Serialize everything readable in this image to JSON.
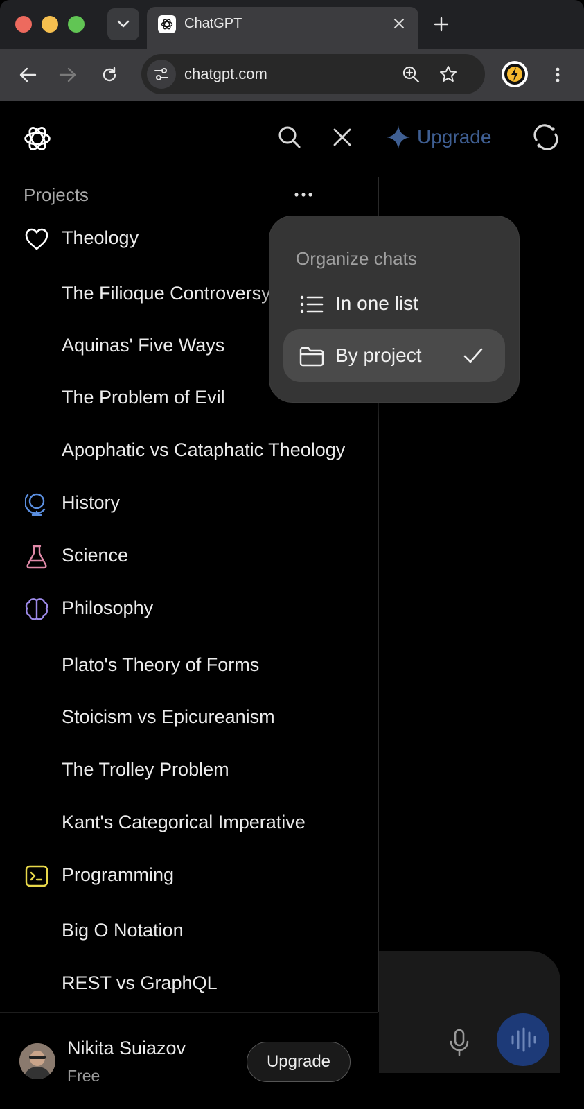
{
  "browser": {
    "tab_title": "ChatGPT",
    "url": "chatgpt.com"
  },
  "header": {
    "upgrade_label": "Upgrade",
    "accent_color": "#3f5f93"
  },
  "sidebar": {
    "projects_heading": "Projects",
    "rows": [
      {
        "kind": "project",
        "label": "Theology",
        "icon": "heart-icon",
        "color": "#ffffff"
      },
      {
        "kind": "chat",
        "label": "The Filioque Controversy"
      },
      {
        "kind": "chat",
        "label": "Aquinas' Five Ways"
      },
      {
        "kind": "chat",
        "label": "The Problem of Evil"
      },
      {
        "kind": "chat",
        "label": "Apophatic vs Cataphatic Theology"
      },
      {
        "kind": "project",
        "label": "History",
        "icon": "globe-icon",
        "color": "#5b8fe0"
      },
      {
        "kind": "project",
        "label": "Science",
        "icon": "flask-icon",
        "color": "#e08aa8"
      },
      {
        "kind": "project",
        "label": "Philosophy",
        "icon": "brain-icon",
        "color": "#9d8ae8"
      },
      {
        "kind": "chat",
        "label": "Plato's Theory of Forms"
      },
      {
        "kind": "chat",
        "label": "Stoicism vs Epicureanism"
      },
      {
        "kind": "chat",
        "label": "The Trolley Problem"
      },
      {
        "kind": "chat",
        "label": "Kant's Categorical Imperative"
      },
      {
        "kind": "project",
        "label": "Programming",
        "icon": "terminal-icon",
        "color": "#e8d84a"
      },
      {
        "kind": "chat",
        "label": "Big O Notation"
      },
      {
        "kind": "chat",
        "label": "REST vs GraphQL"
      }
    ]
  },
  "user": {
    "name": "Nikita Suiazov",
    "plan": "Free",
    "upgrade_label": "Upgrade"
  },
  "popup": {
    "title": "Organize chats",
    "items": [
      {
        "label": "In one list",
        "icon": "list-icon",
        "selected": false
      },
      {
        "label": "By project",
        "icon": "folder-icon",
        "selected": true
      }
    ]
  }
}
